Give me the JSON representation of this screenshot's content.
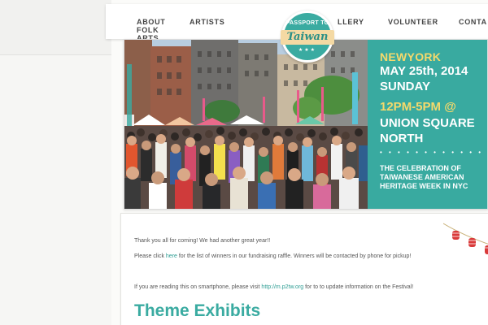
{
  "nav": {
    "about": "ABOUT FOLK ARTS",
    "artists": "ARTISTS",
    "gallery": "LLERY",
    "volunteer": "VOLUNTEER",
    "contact": "CONTA"
  },
  "logo": {
    "top_text": "PASSPORT TO",
    "main_text": "Taiwan",
    "stars": "★★★"
  },
  "banner": {
    "city": "NEWYORK",
    "date": "MAY 25th, 2014",
    "day": "SUNDAY",
    "time": "12PM-5PM",
    "at": " @",
    "venue": "UNION SQUARE NORTH",
    "dots": "• • • • • • • • • • • •",
    "description": "THE CELEBRATION OF TAIWANESE AMERICAN HERITAGE WEEK IN NYC"
  },
  "content": {
    "thanks": "Thank you all for coming! We had another great year!!",
    "winners_pre": "Please click ",
    "winners_link": "here",
    "winners_post": " for the list of winners in our fundraising raffle.  Winners will be contacted by phone for pickup!",
    "mobile_pre": "If you are reading this on smartphone, please visit ",
    "mobile_link": "http://m.p2tw.org",
    "mobile_post": " for to to update information on the Festival!",
    "heading": "Theme Exhibits"
  },
  "colors": {
    "teal": "#39aaa0",
    "yellow": "#f5d96b",
    "lantern": "#d93a3a"
  }
}
